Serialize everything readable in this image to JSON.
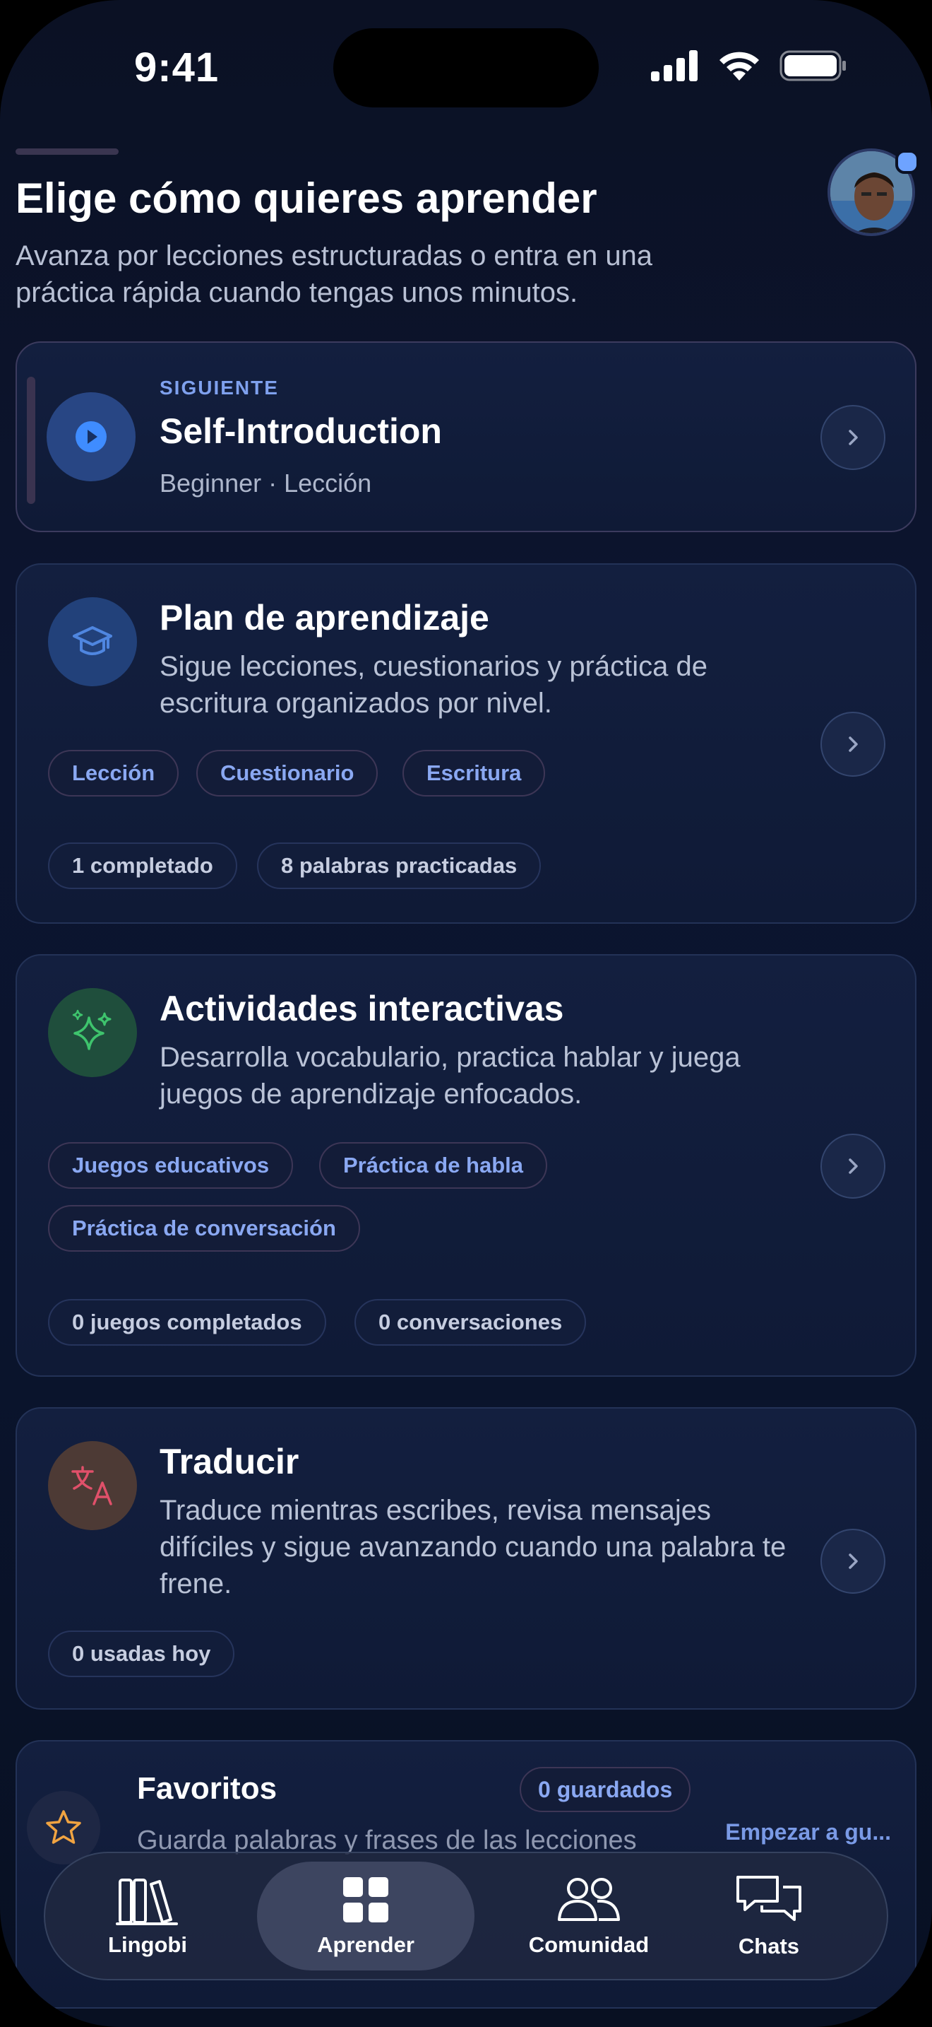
{
  "status_bar": {
    "time": "9:41"
  },
  "header": {
    "title": "Elige cómo quieres aprender",
    "subtitle": "Avanza por lecciones estructuradas o entra en una práctica rápida cuando tengas unos minutos."
  },
  "next_card": {
    "kicker": "SIGUIENTE",
    "title": "Self-Introduction",
    "meta": "Beginner · Lección"
  },
  "plan_card": {
    "title": "Plan de aprendizaje",
    "description": "Sigue lecciones, cuestionarios y práctica de escritura organizados por nivel.",
    "tags": [
      "Lección",
      "Cuestionario",
      "Escritura"
    ],
    "stats": [
      "1 completado",
      "8 palabras practicadas"
    ]
  },
  "activities_card": {
    "title": "Actividades interactivas",
    "description": "Desarrolla vocabulario, practica hablar y juega juegos de aprendizaje enfocados.",
    "tags": [
      "Juegos educativos",
      "Práctica de habla",
      "Práctica de conversación"
    ],
    "stats": [
      "0 juegos completados",
      "0 conversaciones"
    ]
  },
  "translate_card": {
    "title": "Traducir",
    "description": "Traduce mientras escribes, revisa mensajes difíciles y sigue avanzando cuando una palabra te frene.",
    "stats": [
      "0 usadas hoy"
    ]
  },
  "favorites_card": {
    "title": "Favoritos",
    "badge": "0 guardados",
    "description": "Guarda palabras y frases de las lecciones",
    "action": "Empezar a gu..."
  },
  "tab_bar": {
    "tabs": [
      {
        "label": "Lingobi",
        "icon": "books-icon"
      },
      {
        "label": "Aprender",
        "icon": "grid-icon",
        "active": true
      },
      {
        "label": "Comunidad",
        "icon": "people-icon"
      },
      {
        "label": "Chats",
        "icon": "chat-bubbles-icon"
      }
    ]
  },
  "colors": {
    "accent": "#7fa1ee",
    "play_icon": "#3f8cff",
    "cap_icon": "#4f86e0",
    "sparkle_icon": "#3ec46d",
    "translate_icon": "#e0506a",
    "star_icon": "#f0a341"
  }
}
